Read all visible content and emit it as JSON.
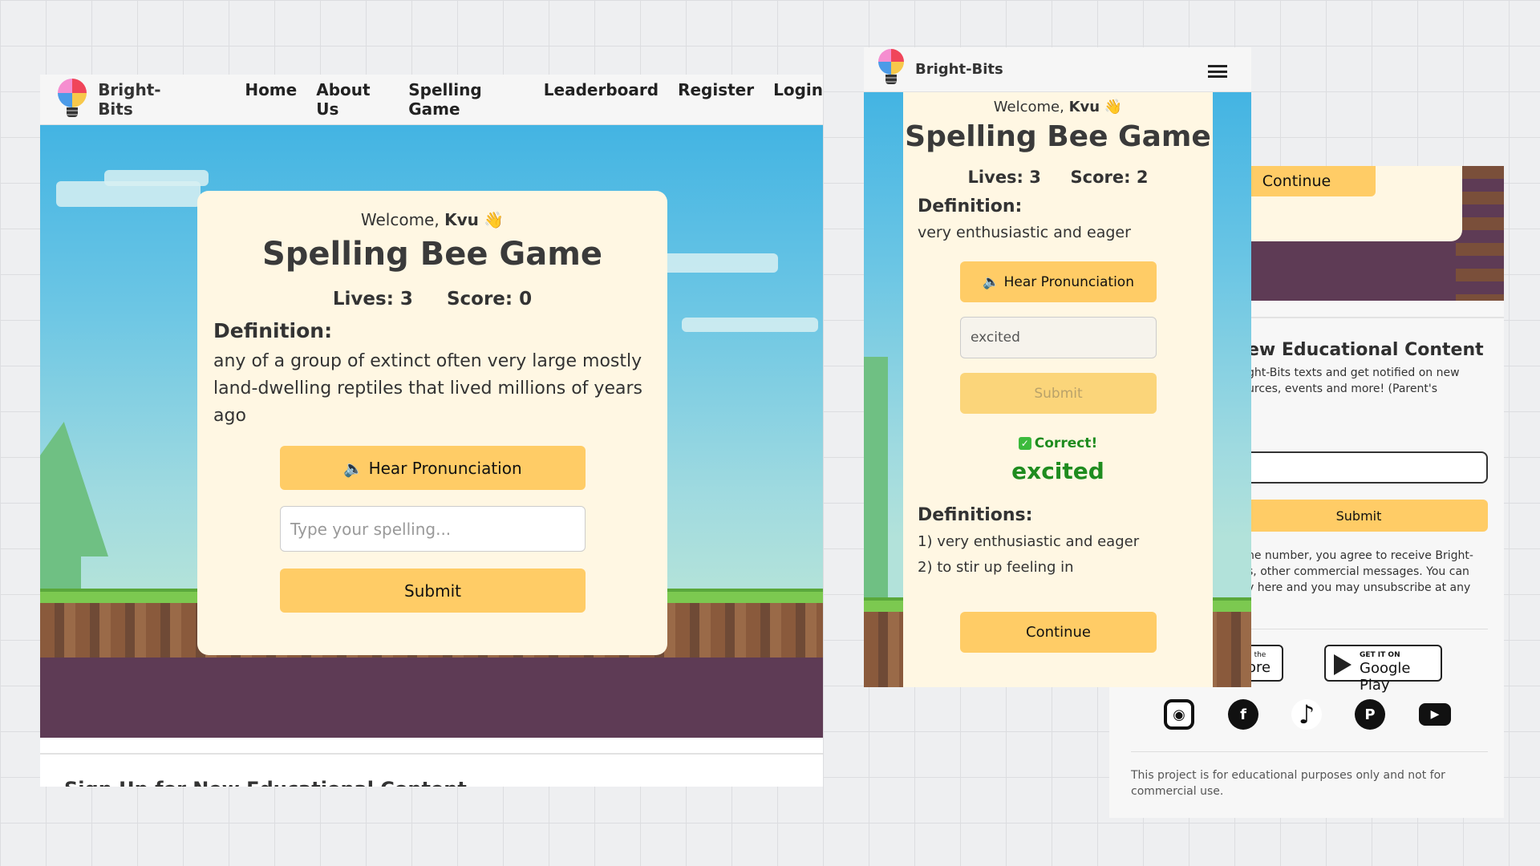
{
  "brand": {
    "name": "Bright-Bits"
  },
  "nav": {
    "links": [
      "Home",
      "About Us",
      "Spelling Game",
      "Leaderboard",
      "Register",
      "Login"
    ]
  },
  "desktop": {
    "welcome_prefix": "Welcome,",
    "username": "Kvu",
    "wave": "👋",
    "title": "Spelling Bee Game",
    "lives": "Lives: 3",
    "score": "Score: 0",
    "definition_heading": "Definition:",
    "definition_text": "any of a group of extinct often very large mostly land-dwelling reptiles that lived millions of years ago",
    "hear_button": "🔈 Hear Pronunciation",
    "input_placeholder": "Type your spelling...",
    "submit_button": "Submit",
    "footer_heading_partial": "Sign  Up for New Educational Content"
  },
  "mobile": {
    "welcome_prefix": "Welcome,",
    "username": "Kvu",
    "wave": "👋",
    "title": "Spelling Bee Game",
    "lives": "Lives: 3",
    "score": "Score: 2",
    "definition_heading": "Definition:",
    "definition_text": "very enthusiastic and eager",
    "hear_button": "🔈 Hear Pronunciation",
    "input_value": "excited",
    "submit_button": "Submit",
    "correct_label": "Correct!",
    "correct_word": "excited",
    "definitions_heading": "Definitions:",
    "definitions": [
      "1) very enthusiastic and eager",
      "2) to stir up feeling in"
    ],
    "continue_button": "Continue"
  },
  "background_panel": {
    "continue_button": "Continue",
    "heading_partial": "ew Educational Content",
    "desc_partial_1": "ght-Bits texts and get notified on new",
    "desc_partial_2": "urces, events and more! (Parent's",
    "submit_button": "Submit",
    "terms_1": "ne number, you agree to receive Bright-",
    "terms_2": "s, other commercial messages. You can",
    "terms_3": "y here and you may unsubscribe at any",
    "app_store_small": "n the",
    "app_store_big": "ore",
    "google_small": "GET IT ON",
    "google_big": "Google Play",
    "social_icons": [
      "instagram-icon",
      "facebook-icon",
      "tiktok-icon",
      "pinterest-icon",
      "youtube-icon"
    ],
    "disclaimer": "This project is for educational purposes only and not for commercial use."
  },
  "colors": {
    "accent": "#ffcc66",
    "card": "#fff7e3",
    "sky": "#43b4e3",
    "ground": "#5e3b55",
    "correct": "#1f8c1f"
  }
}
